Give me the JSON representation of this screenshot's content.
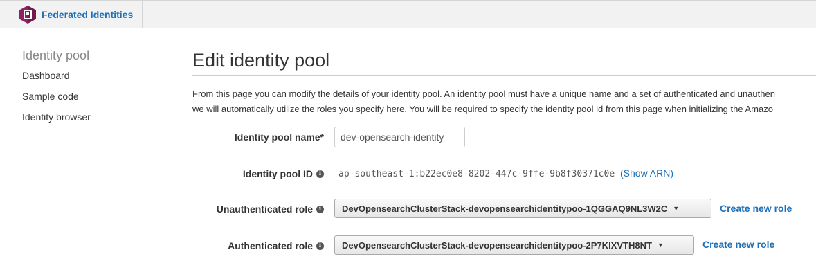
{
  "header": {
    "brand_label": "Federated Identities",
    "brand_icon": "cognito-icon",
    "brand_color": "#8c2463"
  },
  "sidebar": {
    "title": "Identity pool",
    "items": [
      {
        "label": "Dashboard"
      },
      {
        "label": "Sample code"
      },
      {
        "label": "Identity browser"
      }
    ]
  },
  "main": {
    "title": "Edit identity pool",
    "description_line1": "From this page you can modify the details of your identity pool. An identity pool must have a unique name and a set of authenticated and unauthen",
    "description_line2": "we will automatically utilize the roles you specify here. You will be required to specify the identity pool id from this page when initializing the Amazo",
    "fields": {
      "pool_name_label": "Identity pool name*",
      "pool_name_value": "dev-opensearch-identity",
      "pool_id_label": "Identity pool ID",
      "pool_id_value": "ap-southeast-1:b22ec0e8-8202-447c-9ffe-9b8f30371c0e",
      "show_arn_label": "(Show ARN)",
      "unauth_role_label": "Unauthenticated role",
      "unauth_role_value": "DevOpensearchClusterStack-devopensearchidentitypoo-1QGGAQ9NL3W2C",
      "auth_role_label": "Authenticated role",
      "auth_role_value": "DevOpensearchClusterStack-devopensearchidentitypoo-2P7KIXVTH8NT",
      "create_role_label": "Create new role"
    }
  },
  "colors": {
    "link": "#1d70b8",
    "text": "#333333",
    "muted": "#888888"
  }
}
